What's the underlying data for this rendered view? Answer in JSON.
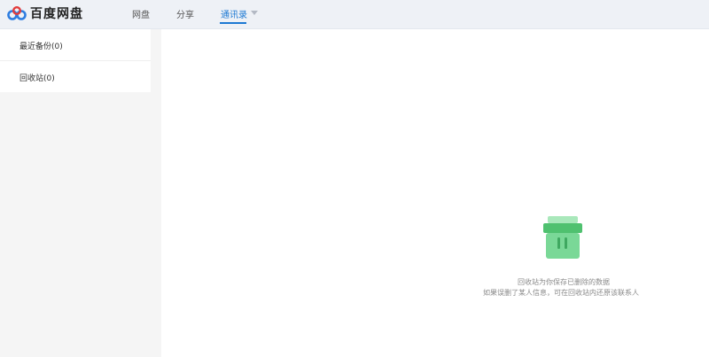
{
  "header": {
    "logo_text": "百度网盘",
    "nav": [
      {
        "label": "网盘"
      },
      {
        "label": "分享"
      },
      {
        "label": "通讯录"
      }
    ],
    "accent_color": "#1d79d3"
  },
  "sidebar": {
    "items": [
      {
        "label": "最近备份(0)"
      },
      {
        "label": "回收站(0)"
      }
    ]
  },
  "empty_state": {
    "icon": "trash-icon",
    "line1": "回收站为你保存已删除的数据",
    "line2": "如果误删了某人信息，可在回收站内还原该联系人",
    "icon_color": "#6fd38b"
  }
}
